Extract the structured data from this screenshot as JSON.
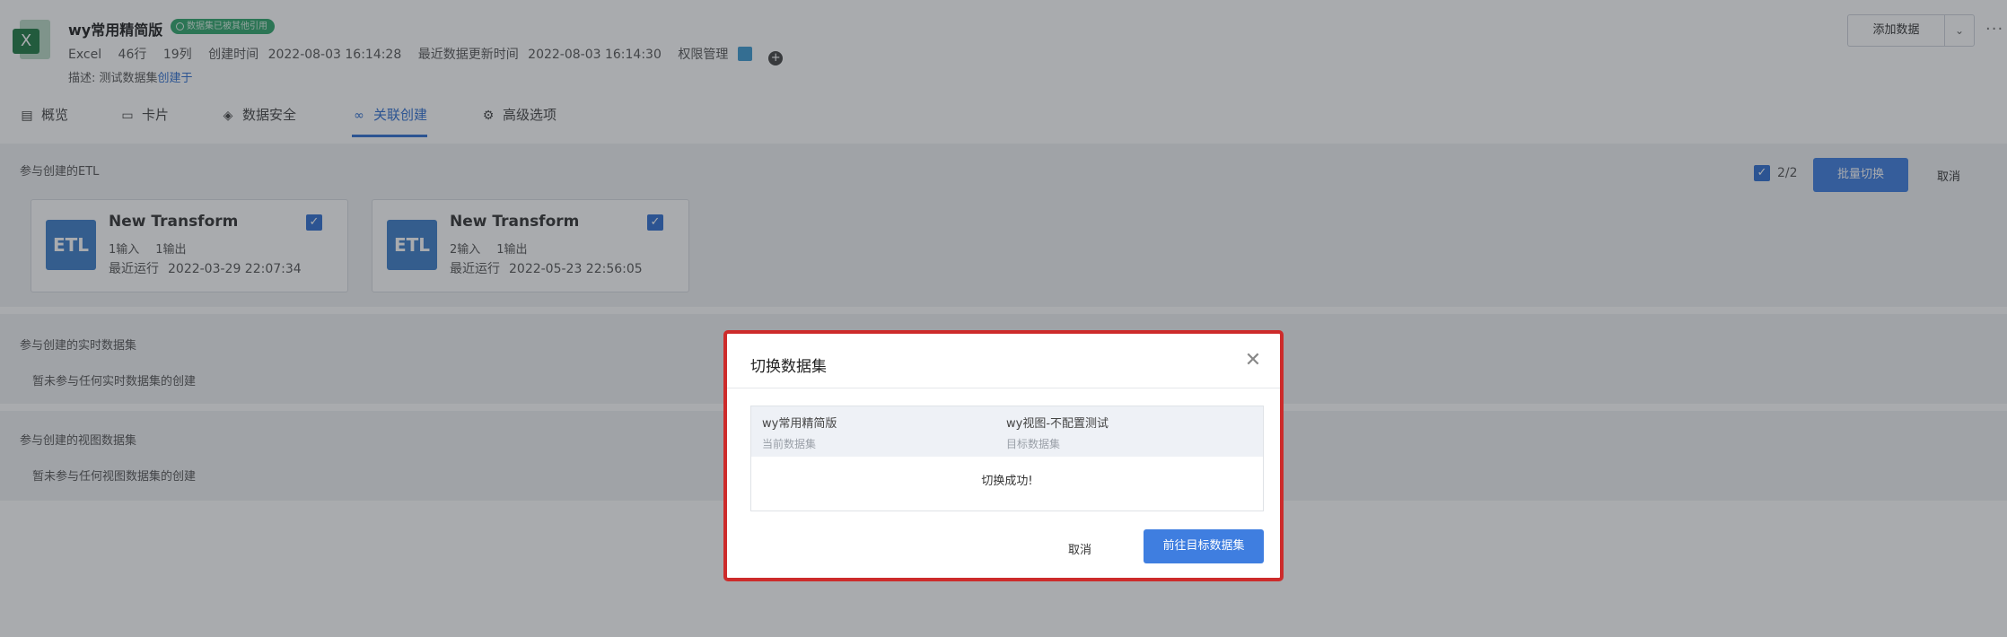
{
  "header": {
    "dataset_title": "wy常用精简版",
    "badge": "数据集已被其他引用",
    "file_type": "Excel",
    "rows": "46行",
    "cols": "19列",
    "created_label": "创建时间",
    "created_time": "2022-08-03 16:14:28",
    "updated_label": "最近数据更新时间",
    "updated_time": "2022-08-03 16:14:30",
    "permission_label": "权限管理",
    "plus_glyph": "+",
    "desc_label": "描述:",
    "desc_text": "测试数据集",
    "desc_link": "创建于",
    "add_data_label": "添加数据",
    "add_caret": "⌄",
    "more": "···"
  },
  "tabs": [
    {
      "label": "概览",
      "icon": "overview-icon",
      "glyph": "▤"
    },
    {
      "label": "卡片",
      "icon": "card-icon",
      "glyph": "▭"
    },
    {
      "label": "数据安全",
      "icon": "shield-icon",
      "glyph": "◈"
    },
    {
      "label": "关联创建",
      "icon": "link-icon",
      "glyph": "∞"
    },
    {
      "label": "高级选项",
      "icon": "gear-icon",
      "glyph": "⚙"
    }
  ],
  "etl_section": {
    "title": "参与创建的ETL",
    "selected_count": "2/2",
    "batch_switch_label": "批量切换",
    "cancel_label": "取消",
    "cards": [
      {
        "logo": "ETL",
        "name": "New Transform",
        "inputs": "1输入",
        "outputs": "1输出",
        "run_label": "最近运行",
        "run_time": "2022-03-29 22:07:34"
      },
      {
        "logo": "ETL",
        "name": "New Transform",
        "inputs": "2输入",
        "outputs": "1输出",
        "run_label": "最近运行",
        "run_time": "2022-05-23 22:56:05"
      }
    ]
  },
  "realtime_section": {
    "title": "参与创建的实时数据集",
    "empty": "暂未参与任何实时数据集的创建"
  },
  "view_section": {
    "title": "参与创建的视图数据集",
    "empty": "暂未参与任何视图数据集的创建"
  },
  "dialog": {
    "title": "切换数据集",
    "close_glyph": "✕",
    "current_name": "wy常用精简版",
    "current_label": "当前数据集",
    "target_name": "wy视图-不配置测试",
    "target_label": "目标数据集",
    "result": "切换成功!",
    "cancel_label": "取消",
    "go_label": "前往目标数据集"
  },
  "colors": {
    "accent": "#3f7ee0",
    "highlight_border": "#cd2b2b",
    "badge_green": "#2fa56b"
  }
}
